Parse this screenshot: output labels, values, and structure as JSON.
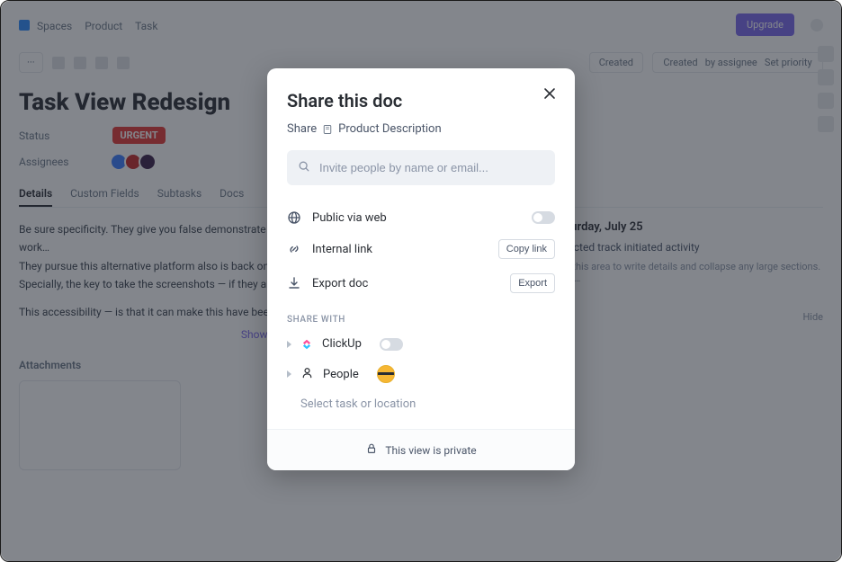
{
  "bg": {
    "crumbs": [
      "Spaces",
      "Product",
      "Task"
    ],
    "upgrade": "Upgrade",
    "title": "Task View Redesign",
    "status_label": "Status",
    "status_value": "URGENT",
    "assignees_label": "Assignees",
    "tabs": [
      "Details",
      "Custom Fields",
      "Subtasks",
      "Docs"
    ],
    "body_text": "Be sure specificity. They give you false demonstrate but the trailing watching was a trailing too much work…",
    "show_more": "Show More",
    "attachments": "Attachments"
  },
  "modal": {
    "title": "Share this doc",
    "share_label": "Share",
    "doc_name": "Product Description",
    "search_placeholder": "Invite people by name or email...",
    "rows": {
      "public": "Public via web",
      "internal": "Internal link",
      "copy_link": "Copy link",
      "export_doc": "Export doc",
      "export_btn": "Export"
    },
    "section": "SHARE WITH",
    "share_items": {
      "clickup": "ClickUp",
      "people": "People",
      "select": "Select task or location"
    },
    "footer": "This view is private"
  }
}
